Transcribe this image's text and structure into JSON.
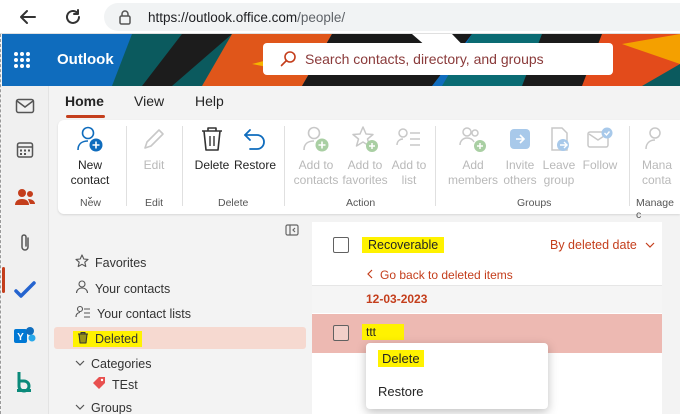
{
  "browser": {
    "url_domain": "https://outlook.office.com",
    "url_path": "/people/"
  },
  "header": {
    "app_name": "Outlook",
    "search_placeholder": "Search contacts, directory, and groups",
    "brand_color": "#0f6cbd"
  },
  "ribbon": {
    "tabs": [
      "Home",
      "View",
      "Help"
    ],
    "active_tab": "Home",
    "buttons": {
      "new_contact_line1": "New",
      "new_contact_line2": "contact",
      "edit": "Edit",
      "delete": "Delete",
      "restore": "Restore",
      "add_to_contacts_1": "Add to",
      "add_to_contacts_2": "contacts",
      "add_to_favorites_1": "Add to",
      "add_to_favorites_2": "favorites",
      "add_to_list_1": "Add to",
      "add_to_list_2": "list",
      "add_members_1": "Add",
      "add_members_2": "members",
      "invite_others_1": "Invite",
      "invite_others_2": "others",
      "leave_group_1": "Leave",
      "leave_group_2": "group",
      "follow": "Follow",
      "manage_contacts_1": "Mana",
      "manage_contacts_2": "conta"
    },
    "groups": {
      "new": "New",
      "edit": "Edit",
      "delete": "Delete",
      "action": "Action",
      "groups": "Groups",
      "manage": "Manage c"
    }
  },
  "nav": {
    "favorites": "Favorites",
    "your_contacts": "Your contacts",
    "your_contact_lists": "Your contact lists",
    "deleted": "Deleted",
    "categories": "Categories",
    "category_item": "TEst",
    "groups": "Groups"
  },
  "list": {
    "title": "Recoverable",
    "sort_label": "By deleted date",
    "back_link": "Go back to deleted items",
    "date_header": "12-03-2023",
    "item_name": "ttt"
  },
  "context_menu": {
    "items": [
      "Delete",
      "Restore"
    ]
  },
  "colors": {
    "accent": "#c43e1c",
    "highlight": "#fff200",
    "selected_row": "#edb9b2"
  }
}
